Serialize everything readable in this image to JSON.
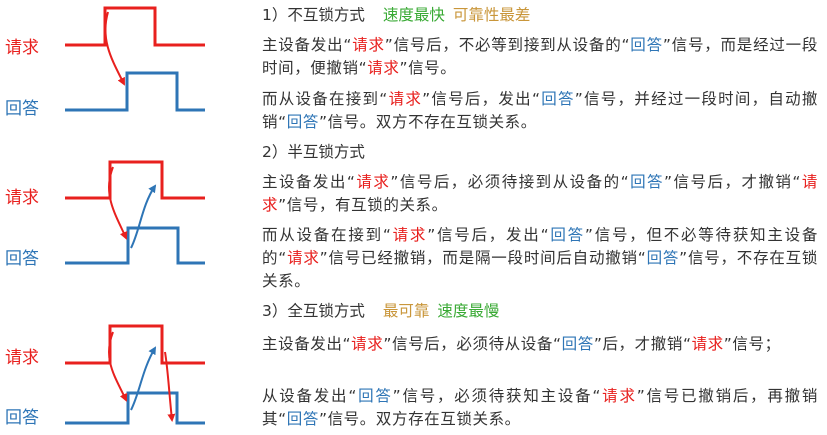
{
  "signals": {
    "request": "请求",
    "answer": "回答"
  },
  "sections": [
    {
      "heading": "1）不互锁方式",
      "tags": [
        {
          "text": "速度最快",
          "color": "#3aaa35"
        },
        {
          "text": "可靠性最差",
          "color": "#c9963a"
        }
      ],
      "p1": [
        {
          "t": "主设备发出“"
        },
        {
          "t": "请求",
          "c": "red"
        },
        {
          "t": "”信号后，不必等到接到从设备的“"
        },
        {
          "t": "回答",
          "c": "blue"
        },
        {
          "t": "”信号，而是经过一段时间，便撤销“"
        },
        {
          "t": "请求",
          "c": "red"
        },
        {
          "t": "”信号。"
        }
      ],
      "p2": [
        {
          "t": "而从设备在接到“"
        },
        {
          "t": "请求",
          "c": "red"
        },
        {
          "t": "”信号后，发出“"
        },
        {
          "t": "回答",
          "c": "blue"
        },
        {
          "t": "”信号，并经过一段时间，自动撤销“"
        },
        {
          "t": "回答",
          "c": "blue"
        },
        {
          "t": "”信号。双方不存在互锁关系。"
        }
      ]
    },
    {
      "heading": "2）半互锁方式",
      "tags": [],
      "p1": [
        {
          "t": "主设备发出“"
        },
        {
          "t": "请求",
          "c": "red"
        },
        {
          "t": "”信号后，必须待接到从设备的“"
        },
        {
          "t": "回答",
          "c": "blue"
        },
        {
          "t": "”信号后，才撤销“"
        },
        {
          "t": "请求",
          "c": "red"
        },
        {
          "t": "”信号，有互锁的关系。"
        }
      ],
      "p2": [
        {
          "t": "而从设备在接到“"
        },
        {
          "t": "请求",
          "c": "red"
        },
        {
          "t": "”信号后，发出“"
        },
        {
          "t": "回答",
          "c": "blue"
        },
        {
          "t": "”信号，但不必等待获知主设备的“"
        },
        {
          "t": "请求",
          "c": "red"
        },
        {
          "t": "”信号已经撤销，而是隔一段时间后自动撤销“"
        },
        {
          "t": "回答",
          "c": "blue"
        },
        {
          "t": "”信号，不存在互锁关系。"
        }
      ]
    },
    {
      "heading": "3）全互锁方式",
      "tags": [
        {
          "text": "最可靠",
          "color": "#c9963a"
        },
        {
          "text": "速度最慢",
          "color": "#3aaa35"
        }
      ],
      "p1": [
        {
          "t": "主设备发出“"
        },
        {
          "t": "请求",
          "c": "red"
        },
        {
          "t": "”信号后，必须待从设备“"
        },
        {
          "t": "回答",
          "c": "blue"
        },
        {
          "t": "”后，才撤销“"
        },
        {
          "t": "请求",
          "c": "red"
        },
        {
          "t": "”信号；"
        }
      ],
      "p2": [
        {
          "t": "从设备发出“"
        },
        {
          "t": "回答",
          "c": "blue"
        },
        {
          "t": "”信号，必须待获知主设备“"
        },
        {
          "t": "请求",
          "c": "red"
        },
        {
          "t": "”信号已撤销后，再撤销其“"
        },
        {
          "t": "回答",
          "c": "blue"
        },
        {
          "t": "”信号。双方存在互锁关系。"
        }
      ]
    }
  ]
}
